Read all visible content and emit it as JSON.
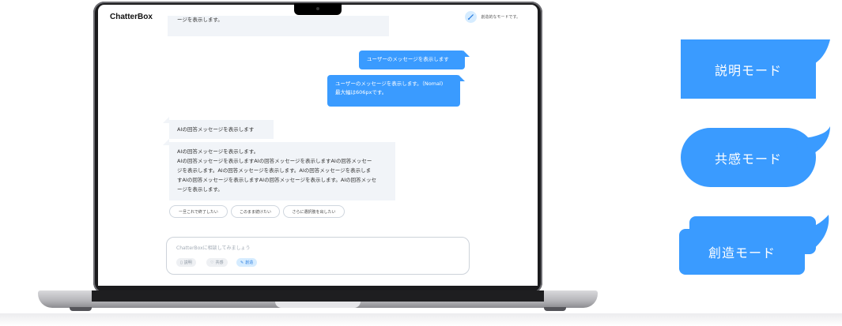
{
  "app": {
    "title": "ChatterBox"
  },
  "header": {
    "mode_indicator_label": "創造的なモードです。"
  },
  "messages": {
    "ai_top_partial": "ージを表示します。",
    "user_1": "ユーザーのメッセージを表示します",
    "user_2_line1": "ユーザーのメッセージを表示します。（Nomal)",
    "user_2_line2": "最大幅は606pxです。",
    "ai_1": "AIの回答メッセージを表示します",
    "ai_2_lines": [
      "AIの回答メッセージを表示します。",
      "AIの回答メッセージを表示しますAIの回答メッセージを表示しますAIの回答メッセー",
      "ジを表示します。AIの回答メッセージを表示します。AIの回答メッセージを表示しま",
      "すAIの回答メッセージを表示しますAIの回答メッセージを表示します。AIの回答メッセ",
      "ージを表示します。"
    ]
  },
  "suggestions": [
    "一旦これで終了したい",
    "このまま続けたい",
    "さらに選択肢を出したい"
  ],
  "input": {
    "placeholder": "ChatterBoxに相談してみましょう",
    "modes": [
      {
        "label": "説明",
        "icon": "book-icon",
        "active": false
      },
      {
        "label": "共感",
        "icon": "heart-hand-icon",
        "active": false
      },
      {
        "label": "創造",
        "icon": "pen-icon",
        "active": true
      }
    ]
  },
  "mode_cards": [
    "説明モード",
    "共感モード",
    "創造モード"
  ],
  "colors": {
    "accent": "#3a9bff",
    "ai_bubble": "#f1f4f8",
    "accent_light": "#d6ecff"
  }
}
